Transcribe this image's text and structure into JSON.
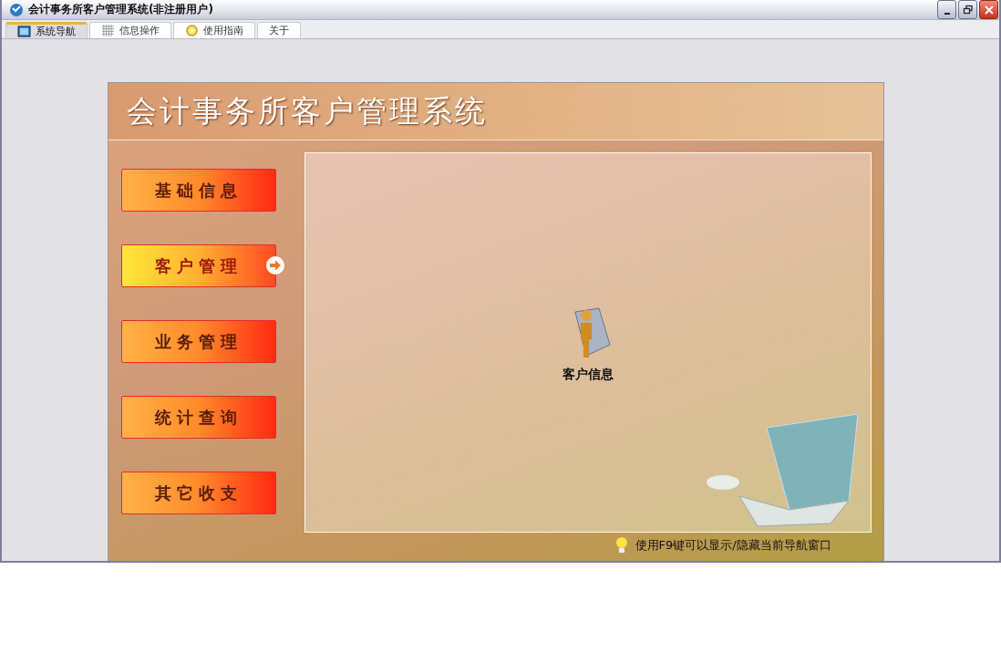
{
  "window": {
    "title": "会计事务所客户管理系统(非注册用户)"
  },
  "tabs": [
    {
      "label": "系统导航",
      "selected": true,
      "kind": "monitor"
    },
    {
      "label": "信息操作",
      "selected": false,
      "kind": "grid"
    },
    {
      "label": "使用指南",
      "selected": false,
      "kind": "help"
    },
    {
      "label": "关于",
      "selected": false,
      "kind": "none"
    }
  ],
  "banner": {
    "title": "会计事务所客户管理系统"
  },
  "menu": [
    {
      "label": "基础信息",
      "selected": false
    },
    {
      "label": "客户管理",
      "selected": true
    },
    {
      "label": "业务管理",
      "selected": false
    },
    {
      "label": "统计查询",
      "selected": false
    },
    {
      "label": "其它收支",
      "selected": false
    }
  ],
  "modules": [
    {
      "label": "客户信息"
    }
  ],
  "tip": "使用F9键可以显示/隐藏当前导航窗口"
}
